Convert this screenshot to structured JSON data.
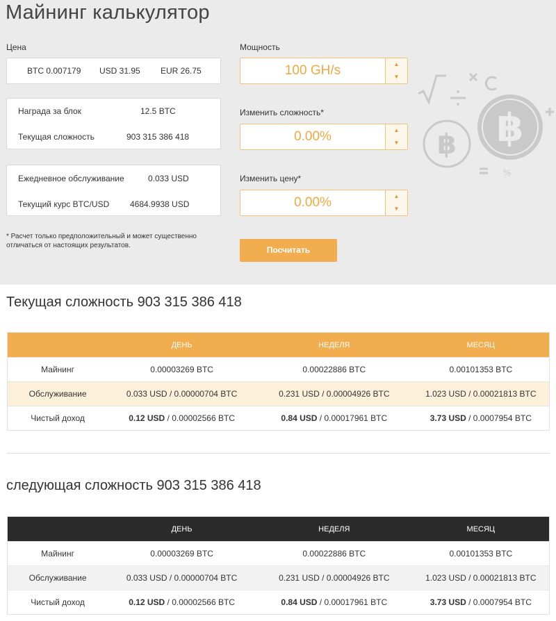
{
  "calculator": {
    "title": "Майнинг калькулятор",
    "price_label": "Цена",
    "price": {
      "btc": "BTC 0.007179",
      "usd": "USD 31.95",
      "eur": "EUR 26.75"
    },
    "block_reward": {
      "label": "Награда за блок",
      "value": "12.5 BTC"
    },
    "current_difficulty": {
      "label": "Текущая сложность",
      "value": "903 315 386 418"
    },
    "daily_maintenance": {
      "label": "Ежедневное обслуживание",
      "value": "0.033 USD"
    },
    "btc_usd_rate": {
      "label": "Текущий курс BTC/USD",
      "value": "4684.9938 USD"
    },
    "note": "* Расчет только предположительный и может существенно отличаться от настоящих результатов.",
    "power": {
      "label": "Мощность",
      "value": "100 GH/s"
    },
    "difficulty_change": {
      "label": "Изменить сложность*",
      "value": "0.00%"
    },
    "price_change": {
      "label": "Изменить цену*",
      "value": "0.00%"
    },
    "calculate_label": "Посчитать",
    "spinner_up": "▲",
    "spinner_down": "▼",
    "icons": [
      "sqrt-icon",
      "divide-icon",
      "multiply-icon",
      "clear-icon",
      "bitcoin-coin-icon",
      "equals-icon",
      "percent-icon",
      "plus-icon"
    ],
    "accent_color": "#f2ad4e"
  },
  "current_section": {
    "title": "Текущая сложность 903 315 386 418",
    "headers": [
      "",
      "ДЕНЬ",
      "НЕДЕЛЯ",
      "МЕСЯЦ"
    ],
    "rows": [
      {
        "label": "Майнинг",
        "cells": [
          {
            "bold": "",
            "rest": "0.00003269 BTC"
          },
          {
            "bold": "",
            "rest": "0.00022886 BTC"
          },
          {
            "bold": "",
            "rest": "0.00101353 BTC"
          }
        ]
      },
      {
        "label": "Обслуживание",
        "cells": [
          {
            "bold": "",
            "rest": "0.033 USD / 0.00000704 BTC"
          },
          {
            "bold": "",
            "rest": "0.231 USD / 0.00004926 BTC"
          },
          {
            "bold": "",
            "rest": "1.023 USD / 0.00021813 BTC"
          }
        ]
      },
      {
        "label": "Чистый доход",
        "cells": [
          {
            "bold": "0.12 USD",
            "rest": " / 0.00002566 BTC"
          },
          {
            "bold": "0.84 USD",
            "rest": " / 0.00017961 BTC"
          },
          {
            "bold": "3.73 USD",
            "rest": " / 0.0007954 BTC"
          }
        ]
      }
    ]
  },
  "next_section": {
    "title": "следующая сложность 903 315 386 418",
    "headers": [
      "",
      "ДЕНЬ",
      "НЕДЕЛЯ",
      "МЕСЯЦ"
    ],
    "rows": [
      {
        "label": "Майнинг",
        "cells": [
          {
            "bold": "",
            "rest": "0.00003269 BTC"
          },
          {
            "bold": "",
            "rest": "0.00022886 BTC"
          },
          {
            "bold": "",
            "rest": "0.00101353 BTC"
          }
        ]
      },
      {
        "label": "Обслуживание",
        "cells": [
          {
            "bold": "",
            "rest": "0.033 USD / 0.00000704 BTC"
          },
          {
            "bold": "",
            "rest": "0.231 USD / 0.00004926 BTC"
          },
          {
            "bold": "",
            "rest": "1.023 USD / 0.00021813 BTC"
          }
        ]
      },
      {
        "label": "Чистый доход",
        "cells": [
          {
            "bold": "0.12 USD",
            "rest": " / 0.00002566 BTC"
          },
          {
            "bold": "0.84 USD",
            "rest": " / 0.00017961 BTC"
          },
          {
            "bold": "3.73 USD",
            "rest": " / 0.0007954 BTC"
          }
        ]
      }
    ]
  }
}
